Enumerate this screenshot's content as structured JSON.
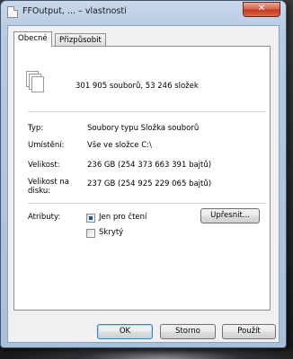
{
  "window": {
    "title": "FFOutput, ... – vlastnosti",
    "close_label": "✕"
  },
  "tabs": [
    {
      "label": "Obecné",
      "active": true
    },
    {
      "label": "Přizpůsobit",
      "active": false
    }
  ],
  "summary": {
    "icon": "multiple-files-icon",
    "text": "301 905 souborů, 53 246 složek"
  },
  "properties": [
    {
      "label": "Typ:",
      "value": "Soubory typu Složka souborů"
    },
    {
      "label": "Umístění:",
      "value": "Vše ve složce C:\\"
    },
    {
      "label": "Velikost:",
      "value": "236 GB (254 373 663 391 bajtů)"
    },
    {
      "label": "Velikost na disku:",
      "value": "237 GB (254 925 229 065 bajtů)"
    }
  ],
  "attributes": {
    "label": "Atributy:",
    "read_only": {
      "label": "Jen pro čtení",
      "checked": true,
      "indeterminate": true
    },
    "hidden": {
      "label": "Skrytý",
      "checked": false
    },
    "advanced_button": "Upřesnit..."
  },
  "buttons": {
    "ok": "OK",
    "cancel": "Storno",
    "apply": "Použít"
  }
}
